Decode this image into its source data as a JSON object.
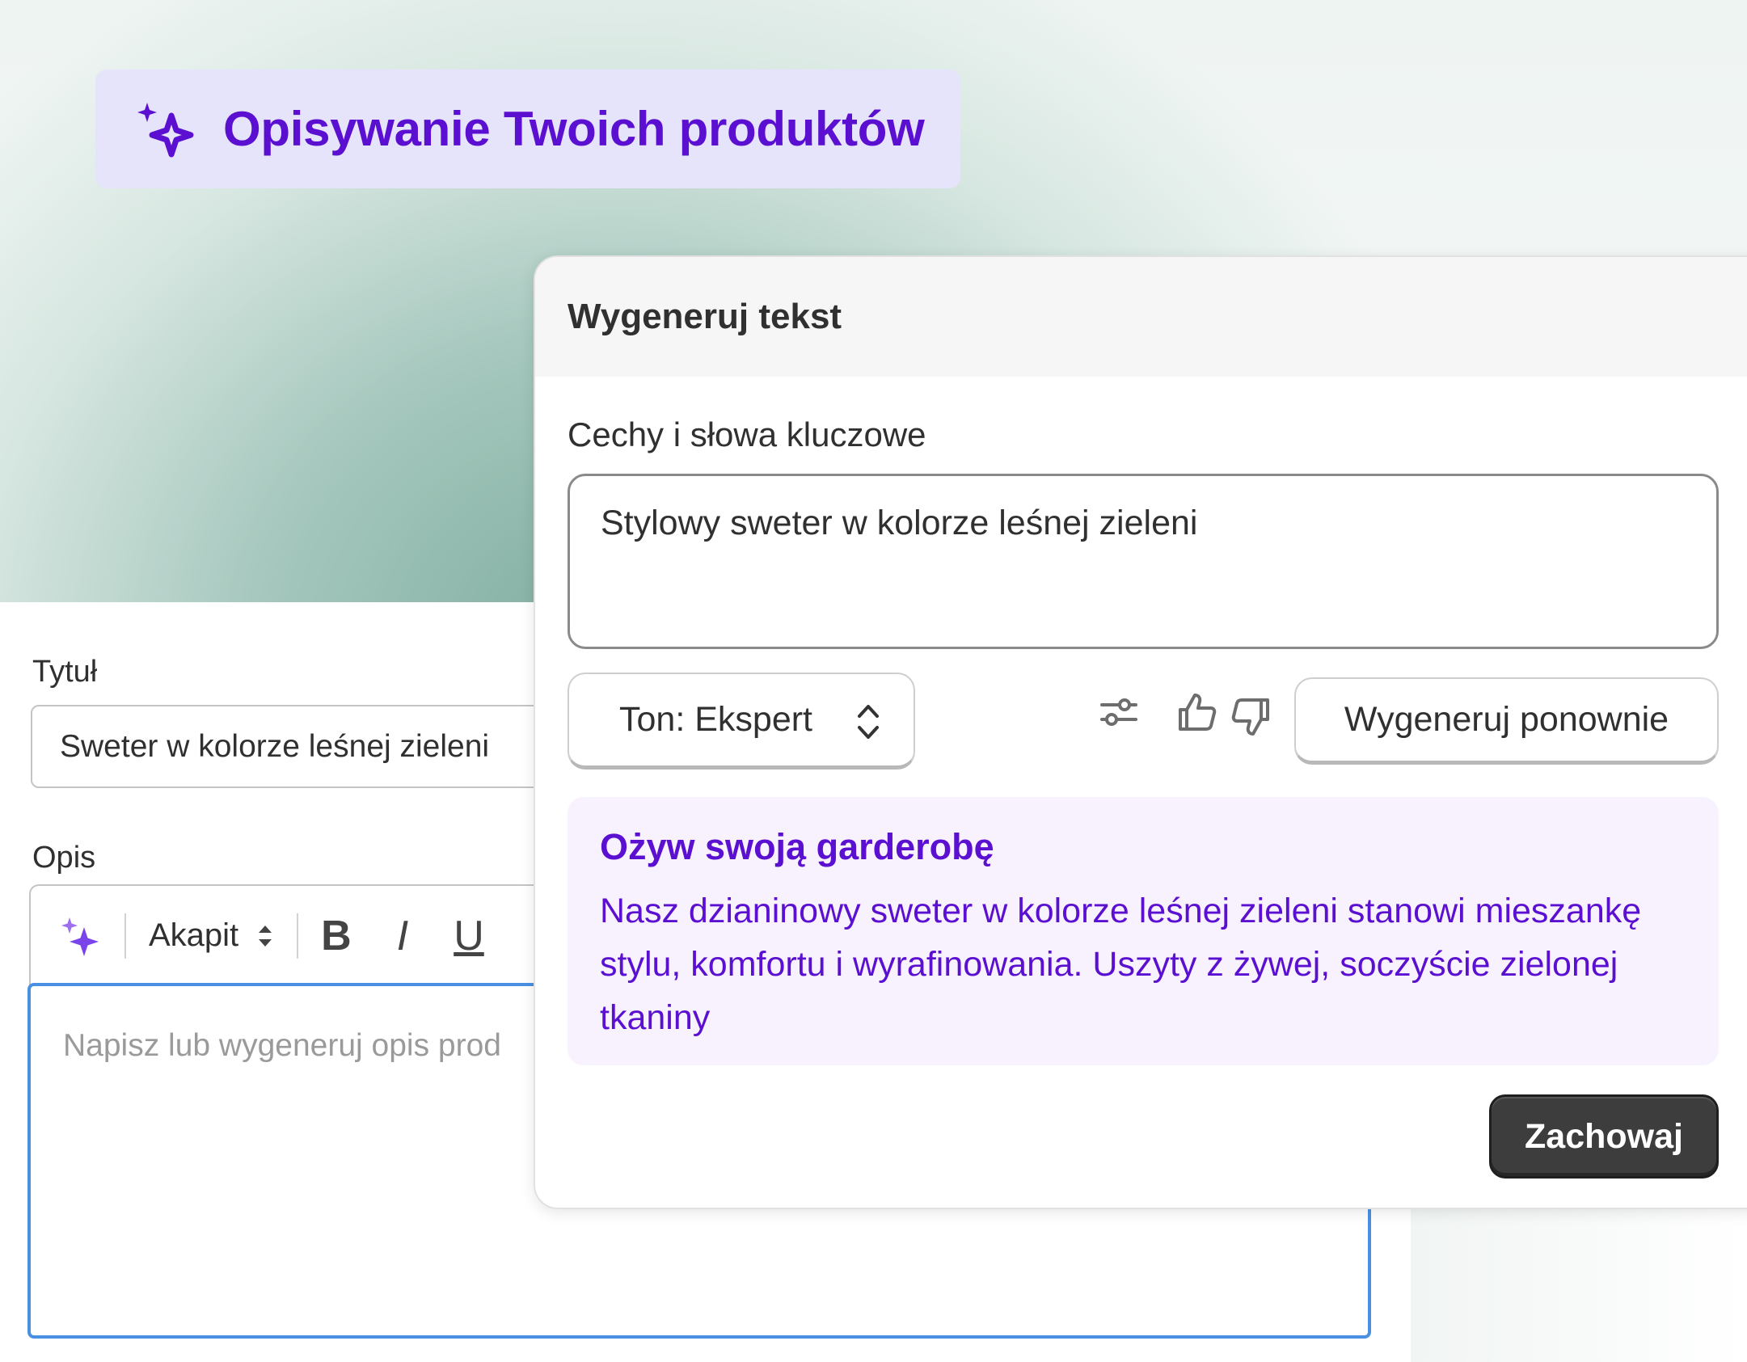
{
  "badge": {
    "title": "Opisywanie Twoich produktów",
    "icon": "sparkle-icon"
  },
  "form": {
    "title_label": "Tytuł",
    "title_value": "Sweter w kolorze leśnej zieleni",
    "description_label": "Opis",
    "toolbar": {
      "paragraph": "Akapit",
      "bold": "B",
      "italic": "I",
      "underline": "U"
    },
    "editor_placeholder": "Napisz lub wygeneruj opis prod"
  },
  "modal": {
    "header": "Wygeneruj tekst",
    "keywords_label": "Cechy i słowa kluczowe",
    "keywords_value": "Stylowy sweter w kolorze leśnej zieleni",
    "tone": "Ton: Ekspert",
    "regenerate_label": "Wygeneruj ponownie",
    "result_title": "Ożyw swoją garderobę",
    "result_body": "Nasz dzianinowy sweter w kolorze leśnej zieleni stanowi mieszankę stylu, komfortu i wyrafinowania. Uszyty z żywej, soczyście zielonej tkaniny",
    "save_label": "Zachowaj"
  },
  "colors": {
    "accent": "#5b0fd0",
    "focus": "#4a90e2",
    "badge_bg": "#e6e4fb",
    "result_bg": "#f7f2fe"
  }
}
